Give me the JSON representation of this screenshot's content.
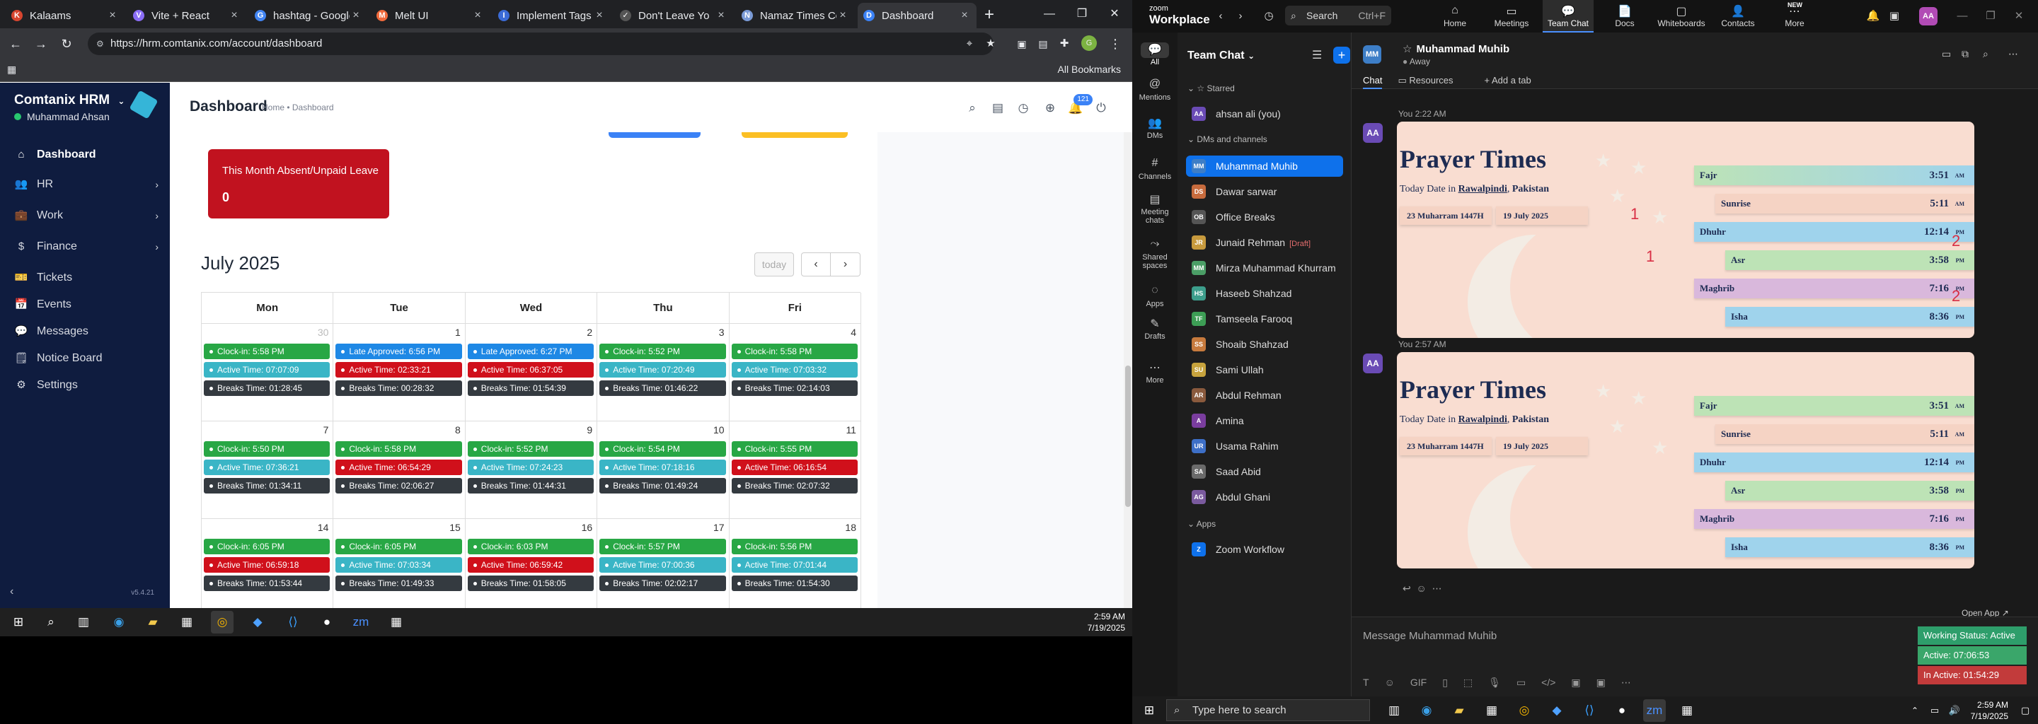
{
  "chrome": {
    "tabs": [
      {
        "title": "Kalaams",
        "fav": "K",
        "color": "#d6452f"
      },
      {
        "title": "Vite + React",
        "fav": "V",
        "color": "#8a6df5"
      },
      {
        "title": "hashtag - Google",
        "fav": "G",
        "color": "#4285f4"
      },
      {
        "title": "Melt UI",
        "fav": "M",
        "color": "#f06a3c"
      },
      {
        "title": "Implement Tags in",
        "fav": "I",
        "color": "#3b6bd6"
      },
      {
        "title": "Don't Leave Yo",
        "fav": "✓",
        "color": "#555555"
      },
      {
        "title": "Namaz Times Col",
        "fav": "N",
        "color": "#7a9ad6"
      },
      {
        "title": "Dashboard",
        "fav": "D",
        "color": "#3b82f6"
      }
    ],
    "active_tab": 7,
    "url": "https://hrm.comtanix.com/account/dashboard",
    "all_bookmarks": "All Bookmarks"
  },
  "hrm": {
    "brand": "Comtanix HRM",
    "user": "Muhammad Ahsan",
    "nav": [
      {
        "label": "Dashboard",
        "icon": "home-icon",
        "glyph": "⌂",
        "chevron": false,
        "active": true
      },
      {
        "label": "HR",
        "icon": "users-icon",
        "glyph": "👥",
        "chevron": true
      },
      {
        "label": "Work",
        "icon": "briefcase-icon",
        "glyph": "💼",
        "chevron": true
      },
      {
        "label": "Finance",
        "icon": "dollar-icon",
        "glyph": "$",
        "chevron": true
      },
      {
        "label": "Tickets",
        "icon": "ticket-icon",
        "glyph": "🎫",
        "chevron": false
      },
      {
        "label": "Events",
        "icon": "calendar-icon",
        "glyph": "📅",
        "chevron": false
      },
      {
        "label": "Messages",
        "icon": "message-icon",
        "glyph": "💬",
        "chevron": false
      },
      {
        "label": "Notice Board",
        "icon": "board-icon",
        "glyph": "🗒",
        "chevron": false
      },
      {
        "label": "Settings",
        "icon": "gear-icon",
        "glyph": "⚙",
        "chevron": false
      }
    ],
    "version": "v5.4.21",
    "page_title": "Dashboard",
    "breadcrumb": "Home • Dashboard",
    "notif_count": "121",
    "absent_card": {
      "label": "This Month Absent/Unpaid Leave",
      "value": "0"
    },
    "calendar": {
      "title": "July 2025",
      "today": "today",
      "days": [
        "Mon",
        "Tue",
        "Wed",
        "Thu",
        "Fri"
      ],
      "weeks": [
        [
          {
            "d": "30",
            "muted": true,
            "ev": [
              [
                "Clock-in: 5:58 PM",
                "g"
              ],
              [
                "Active Time: 07:07:09",
                "c"
              ],
              [
                "Breaks Time: 01:28:45",
                "k"
              ]
            ]
          },
          {
            "d": "1",
            "ev": [
              [
                "Late Approved: 6:56 PM",
                "b"
              ],
              [
                "Active Time: 02:33:21",
                "r"
              ],
              [
                "Breaks Time: 00:28:32",
                "k"
              ]
            ]
          },
          {
            "d": "2",
            "ev": [
              [
                "Late Approved: 6:27 PM",
                "b"
              ],
              [
                "Active Time: 06:37:05",
                "r"
              ],
              [
                "Breaks Time: 01:54:39",
                "k"
              ]
            ]
          },
          {
            "d": "3",
            "ev": [
              [
                "Clock-in: 5:52 PM",
                "g"
              ],
              [
                "Active Time: 07:20:49",
                "c"
              ],
              [
                "Breaks Time: 01:46:22",
                "k"
              ]
            ]
          },
          {
            "d": "4",
            "ev": [
              [
                "Clock-in: 5:58 PM",
                "g"
              ],
              [
                "Active Time: 07:03:32",
                "c"
              ],
              [
                "Breaks Time: 02:14:03",
                "k"
              ]
            ]
          }
        ],
        [
          {
            "d": "7",
            "ev": [
              [
                "Clock-in: 5:50 PM",
                "g"
              ],
              [
                "Active Time: 07:36:21",
                "c"
              ],
              [
                "Breaks Time: 01:34:11",
                "k"
              ]
            ]
          },
          {
            "d": "8",
            "ev": [
              [
                "Clock-in: 5:58 PM",
                "g"
              ],
              [
                "Active Time: 06:54:29",
                "r"
              ],
              [
                "Breaks Time: 02:06:27",
                "k"
              ]
            ]
          },
          {
            "d": "9",
            "ev": [
              [
                "Clock-in: 5:52 PM",
                "g"
              ],
              [
                "Active Time: 07:24:23",
                "c"
              ],
              [
                "Breaks Time: 01:44:31",
                "k"
              ]
            ]
          },
          {
            "d": "10",
            "ev": [
              [
                "Clock-in: 5:54 PM",
                "g"
              ],
              [
                "Active Time: 07:18:16",
                "c"
              ],
              [
                "Breaks Time: 01:49:24",
                "k"
              ]
            ]
          },
          {
            "d": "11",
            "ev": [
              [
                "Clock-in: 5:55 PM",
                "g"
              ],
              [
                "Active Time: 06:16:54",
                "r"
              ],
              [
                "Breaks Time: 02:07:32",
                "k"
              ]
            ]
          }
        ],
        [
          {
            "d": "14",
            "ev": [
              [
                "Clock-in: 6:05 PM",
                "g"
              ],
              [
                "Active Time: 06:59:18",
                "r"
              ],
              [
                "Breaks Time: 01:53:44",
                "k"
              ]
            ]
          },
          {
            "d": "15",
            "ev": [
              [
                "Clock-in: 6:05 PM",
                "g"
              ],
              [
                "Active Time: 07:03:34",
                "c"
              ],
              [
                "Breaks Time: 01:49:33",
                "k"
              ]
            ]
          },
          {
            "d": "16",
            "ev": [
              [
                "Clock-in: 6:03 PM",
                "g"
              ],
              [
                "Active Time: 06:59:42",
                "r"
              ],
              [
                "Breaks Time: 01:58:05",
                "k"
              ]
            ]
          },
          {
            "d": "17",
            "ev": [
              [
                "Clock-in: 5:57 PM",
                "g"
              ],
              [
                "Active Time: 07:00:36",
                "c"
              ],
              [
                "Breaks Time: 02:02:17",
                "k"
              ]
            ]
          },
          {
            "d": "18",
            "ev": [
              [
                "Clock-in: 5:56 PM",
                "g"
              ],
              [
                "Active Time: 07:01:44",
                "c"
              ],
              [
                "Breaks Time: 01:54:30",
                "k"
              ]
            ]
          }
        ]
      ]
    }
  },
  "event_colors": {
    "g": "#28a745",
    "c": "#3ab5c6",
    "r": "#d0101b",
    "b": "#1e88e5",
    "k": "#343a40"
  },
  "taskbar_left": {
    "time": "2:59 AM",
    "date": "7/19/2025"
  },
  "zoom": {
    "logo_top": "zoom",
    "logo_bottom": "Workplace",
    "search": "Search",
    "search_hotkey": "Ctrl+F",
    "tabs": [
      {
        "label": "Home",
        "glyph": "⌂"
      },
      {
        "label": "Meetings",
        "glyph": "▭"
      },
      {
        "label": "Team Chat",
        "glyph": "💬",
        "active": true
      },
      {
        "label": "Docs",
        "glyph": "📄"
      },
      {
        "label": "Whiteboards",
        "glyph": "▢"
      },
      {
        "label": "Contacts",
        "glyph": "👤"
      },
      {
        "label": "More",
        "glyph": "⋯",
        "badge": "NEW"
      }
    ],
    "avatar_top": "AA",
    "rail": [
      {
        "label": "All",
        "glyph": "💬",
        "active": true
      },
      {
        "label": "Mentions",
        "glyph": "@"
      },
      {
        "label": "DMs",
        "glyph": "👥"
      },
      {
        "label": "Channels",
        "glyph": "#"
      },
      {
        "label": "Meeting chats",
        "glyph": "▤"
      },
      {
        "label": "Shared spaces",
        "glyph": "⤳"
      },
      {
        "label": "Apps",
        "glyph": "◌"
      },
      {
        "label": "Drafts",
        "glyph": "✎"
      },
      {
        "label": "More",
        "glyph": "⋯"
      }
    ],
    "list_title": "Team Chat",
    "sections": {
      "starred": "Starred",
      "dms": "DMs and channels",
      "apps": "Apps"
    },
    "starred": [
      {
        "name": "ahsan ali (you)",
        "av": "AA",
        "color": "#6a4bb5"
      }
    ],
    "contacts": [
      {
        "name": "Muhammad Muhib",
        "av": "MM",
        "color": "#3d7ec7",
        "active": true
      },
      {
        "name": "Dawar sarwar",
        "av": "DS",
        "color": "#c76b3d"
      },
      {
        "name": "Office Breaks",
        "av": "OB",
        "color": "#555555"
      },
      {
        "name": "Junaid Rehman",
        "av": "JR",
        "color": "#c79a3d",
        "draft": "[Draft]"
      },
      {
        "name": "Mirza Muhammad Khurram",
        "av": "MM",
        "color": "#4b9e66"
      },
      {
        "name": "Haseeb Shahzad",
        "av": "HS",
        "color": "#3d9e8c"
      },
      {
        "name": "Tamseela Farooq",
        "av": "TF",
        "color": "#3d9e55"
      },
      {
        "name": "Shoaib Shahzad",
        "av": "SS",
        "color": "#c77a3d"
      },
      {
        "name": "Sami Ullah",
        "av": "SU",
        "color": "#c7a33d"
      },
      {
        "name": "Abdul Rehman",
        "av": "AR",
        "color": "#8a5a3d"
      },
      {
        "name": "Amina",
        "av": "A",
        "color": "#7a3d9e"
      },
      {
        "name": "Usama Rahim",
        "av": "UR",
        "color": "#3d6fc7"
      },
      {
        "name": "Saad Abid",
        "av": "SA",
        "color": "#6a6a6a"
      },
      {
        "name": "Abdul Ghani",
        "av": "AG",
        "color": "#7a5a9e"
      }
    ],
    "apps": [
      {
        "name": "Zoom Workflow",
        "av": "Z",
        "color": "#0e71eb"
      }
    ],
    "chat": {
      "name": "Muhammad Muhib",
      "status": "Away",
      "avatar": "MM",
      "tabs": [
        "Chat",
        "Resources",
        "Add a tab"
      ],
      "messages": [
        {
          "meta": "You 2:22 AM",
          "annotated": true
        },
        {
          "meta": "You 2:57 AM",
          "annotated": false
        }
      ],
      "my_avatar": "AA",
      "composer_placeholder": "Message Muhammad Muhib",
      "open_app": "Open App",
      "gif_label": "GIF"
    },
    "prayer": {
      "title": "Prayer Times",
      "date_prefix": "Today Date in",
      "city": "Rawalpindi",
      "country": "Pakistan",
      "hijri": "23 Muharram 1447H",
      "gregorian": "19 July 2025",
      "times": [
        {
          "name": "Fajr",
          "time": "3:51",
          "ampm": "AM"
        },
        {
          "name": "Sunrise",
          "time": "5:11",
          "ampm": "AM"
        },
        {
          "name": "Dhuhr",
          "time": "12:14",
          "ampm": "PM"
        },
        {
          "name": "Asr",
          "time": "3:58",
          "ampm": "PM"
        },
        {
          "name": "Maghrib",
          "time": "7:16",
          "ampm": "PM"
        },
        {
          "name": "Isha",
          "time": "8:36",
          "ampm": "PM"
        }
      ]
    },
    "ink_marks": [
      "1",
      "1",
      "2",
      "2"
    ],
    "status_pills": [
      {
        "text": "Working Status: Active",
        "color": "#2e9e6b"
      },
      {
        "text": "Active: 07:06:53",
        "color": "#3aa66a"
      },
      {
        "text": "In Active: 01:54:29",
        "color": "#c23b3b"
      }
    ]
  },
  "taskbar_right": {
    "search": "Type here to search",
    "time": "2:59 AM",
    "date": "7/19/2025"
  }
}
